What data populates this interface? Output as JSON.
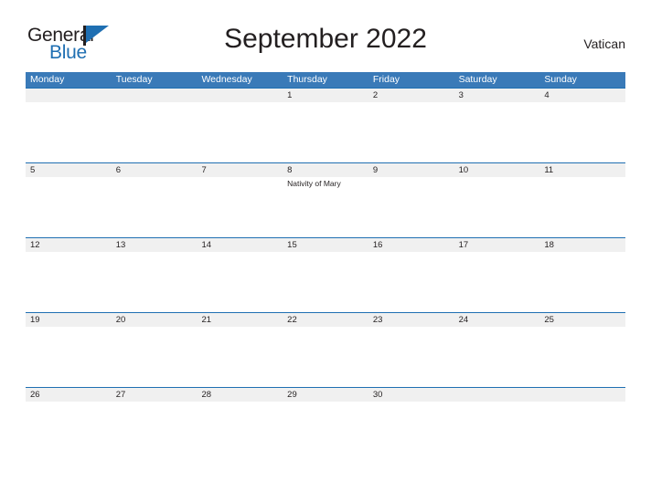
{
  "brand": {
    "name_part1": "General",
    "name_part2": "Blue",
    "flag_icon": "flag-icon",
    "accent_color": "#1f6fb2"
  },
  "header": {
    "title": "September 2022",
    "region": "Vatican"
  },
  "calendar": {
    "header_bg": "#3a7ab8",
    "number_strip_bg": "#f0f0f0",
    "rule_color": "#1f6fb2",
    "weekdays": [
      "Monday",
      "Tuesday",
      "Wednesday",
      "Thursday",
      "Friday",
      "Saturday",
      "Sunday"
    ],
    "weeks": [
      {
        "days": [
          {
            "number": "",
            "events": []
          },
          {
            "number": "",
            "events": []
          },
          {
            "number": "",
            "events": []
          },
          {
            "number": "1",
            "events": []
          },
          {
            "number": "2",
            "events": []
          },
          {
            "number": "3",
            "events": []
          },
          {
            "number": "4",
            "events": []
          }
        ]
      },
      {
        "days": [
          {
            "number": "5",
            "events": []
          },
          {
            "number": "6",
            "events": []
          },
          {
            "number": "7",
            "events": []
          },
          {
            "number": "8",
            "events": [
              "Nativity of Mary"
            ]
          },
          {
            "number": "9",
            "events": []
          },
          {
            "number": "10",
            "events": []
          },
          {
            "number": "11",
            "events": []
          }
        ]
      },
      {
        "days": [
          {
            "number": "12",
            "events": []
          },
          {
            "number": "13",
            "events": []
          },
          {
            "number": "14",
            "events": []
          },
          {
            "number": "15",
            "events": []
          },
          {
            "number": "16",
            "events": []
          },
          {
            "number": "17",
            "events": []
          },
          {
            "number": "18",
            "events": []
          }
        ]
      },
      {
        "days": [
          {
            "number": "19",
            "events": []
          },
          {
            "number": "20",
            "events": []
          },
          {
            "number": "21",
            "events": []
          },
          {
            "number": "22",
            "events": []
          },
          {
            "number": "23",
            "events": []
          },
          {
            "number": "24",
            "events": []
          },
          {
            "number": "25",
            "events": []
          }
        ]
      },
      {
        "days": [
          {
            "number": "26",
            "events": []
          },
          {
            "number": "27",
            "events": []
          },
          {
            "number": "28",
            "events": []
          },
          {
            "number": "29",
            "events": []
          },
          {
            "number": "30",
            "events": []
          },
          {
            "number": "",
            "events": []
          },
          {
            "number": "",
            "events": []
          }
        ]
      }
    ]
  }
}
